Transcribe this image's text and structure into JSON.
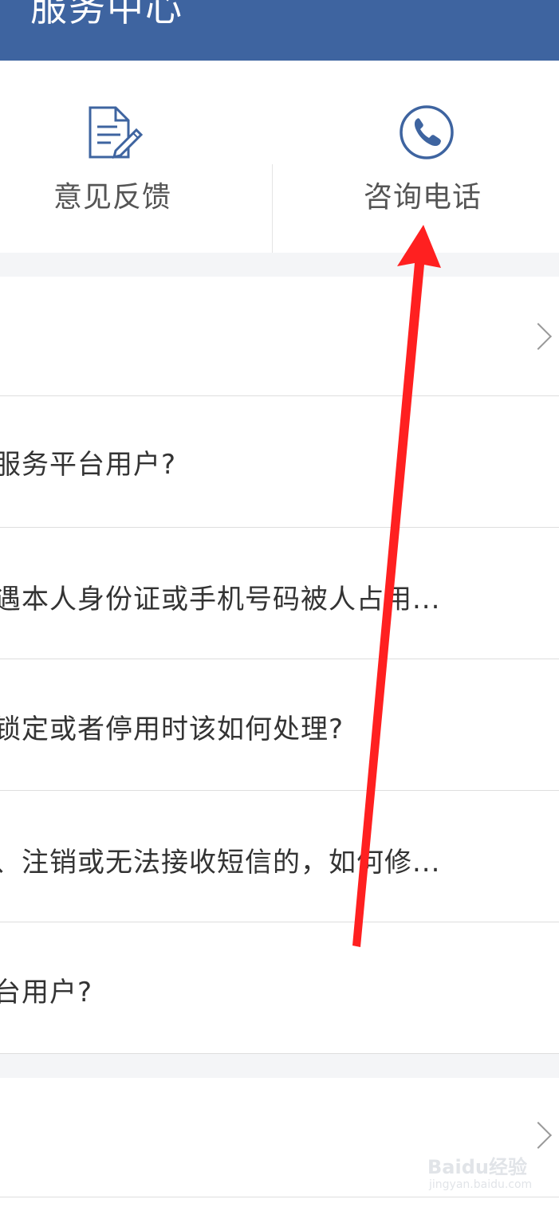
{
  "header": {
    "title": "服务中心"
  },
  "actions": [
    {
      "label": "意见反馈",
      "icon": "document-edit-icon"
    },
    {
      "label": "咨询电话",
      "icon": "phone-icon"
    }
  ],
  "faq": {
    "items": [
      {
        "text": "服务平台用户?"
      },
      {
        "text": "遇本人身份证或手机号码被人占用..."
      },
      {
        "text": "锁定或者停用时该如何处理?"
      },
      {
        "text": "、注销或无法接收短信的，如何修..."
      },
      {
        "text": "台用户?"
      }
    ]
  },
  "watermark": {
    "logo": "Baidu经验",
    "url": "jingyan.baidu.com"
  },
  "colors": {
    "header_bg": "#3e64a0",
    "icon_blue": "#3e64a0",
    "annotation_arrow": "#ff2020",
    "separator": "#f4f5f7"
  }
}
